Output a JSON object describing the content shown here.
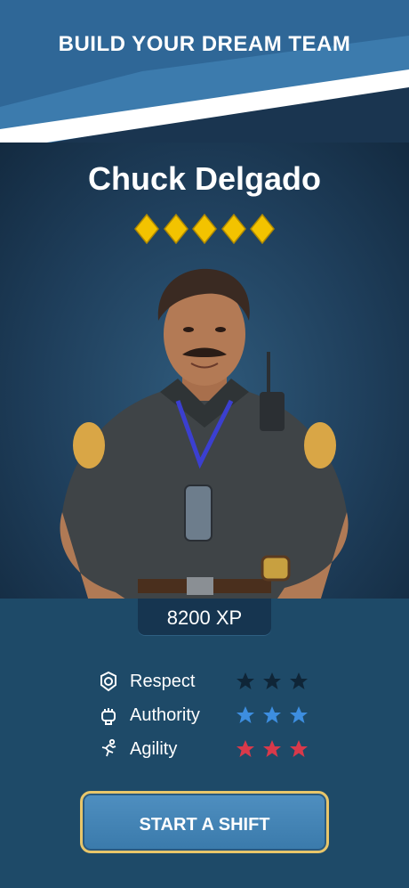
{
  "header": {
    "title": "BUILD YOUR DREAM TEAM"
  },
  "character": {
    "name": "Chuck Delgado",
    "rank_diamonds": 5,
    "xp_label": "8200 XP"
  },
  "stats": [
    {
      "label": "Respect",
      "icon": "badge-icon",
      "stars_filled": 3,
      "star_color": "#0f2537"
    },
    {
      "label": "Authority",
      "icon": "fist-icon",
      "stars_filled": 3,
      "star_color": "#3d8ee0"
    },
    {
      "label": "Agility",
      "icon": "runner-icon",
      "stars_filled": 3,
      "star_color": "#d9394a"
    }
  ],
  "cta": {
    "label": "START A SHIFT"
  },
  "colors": {
    "accent_gold": "#f3c300",
    "button_border": "#e8c66a",
    "button_fill": "#4a88b9"
  }
}
